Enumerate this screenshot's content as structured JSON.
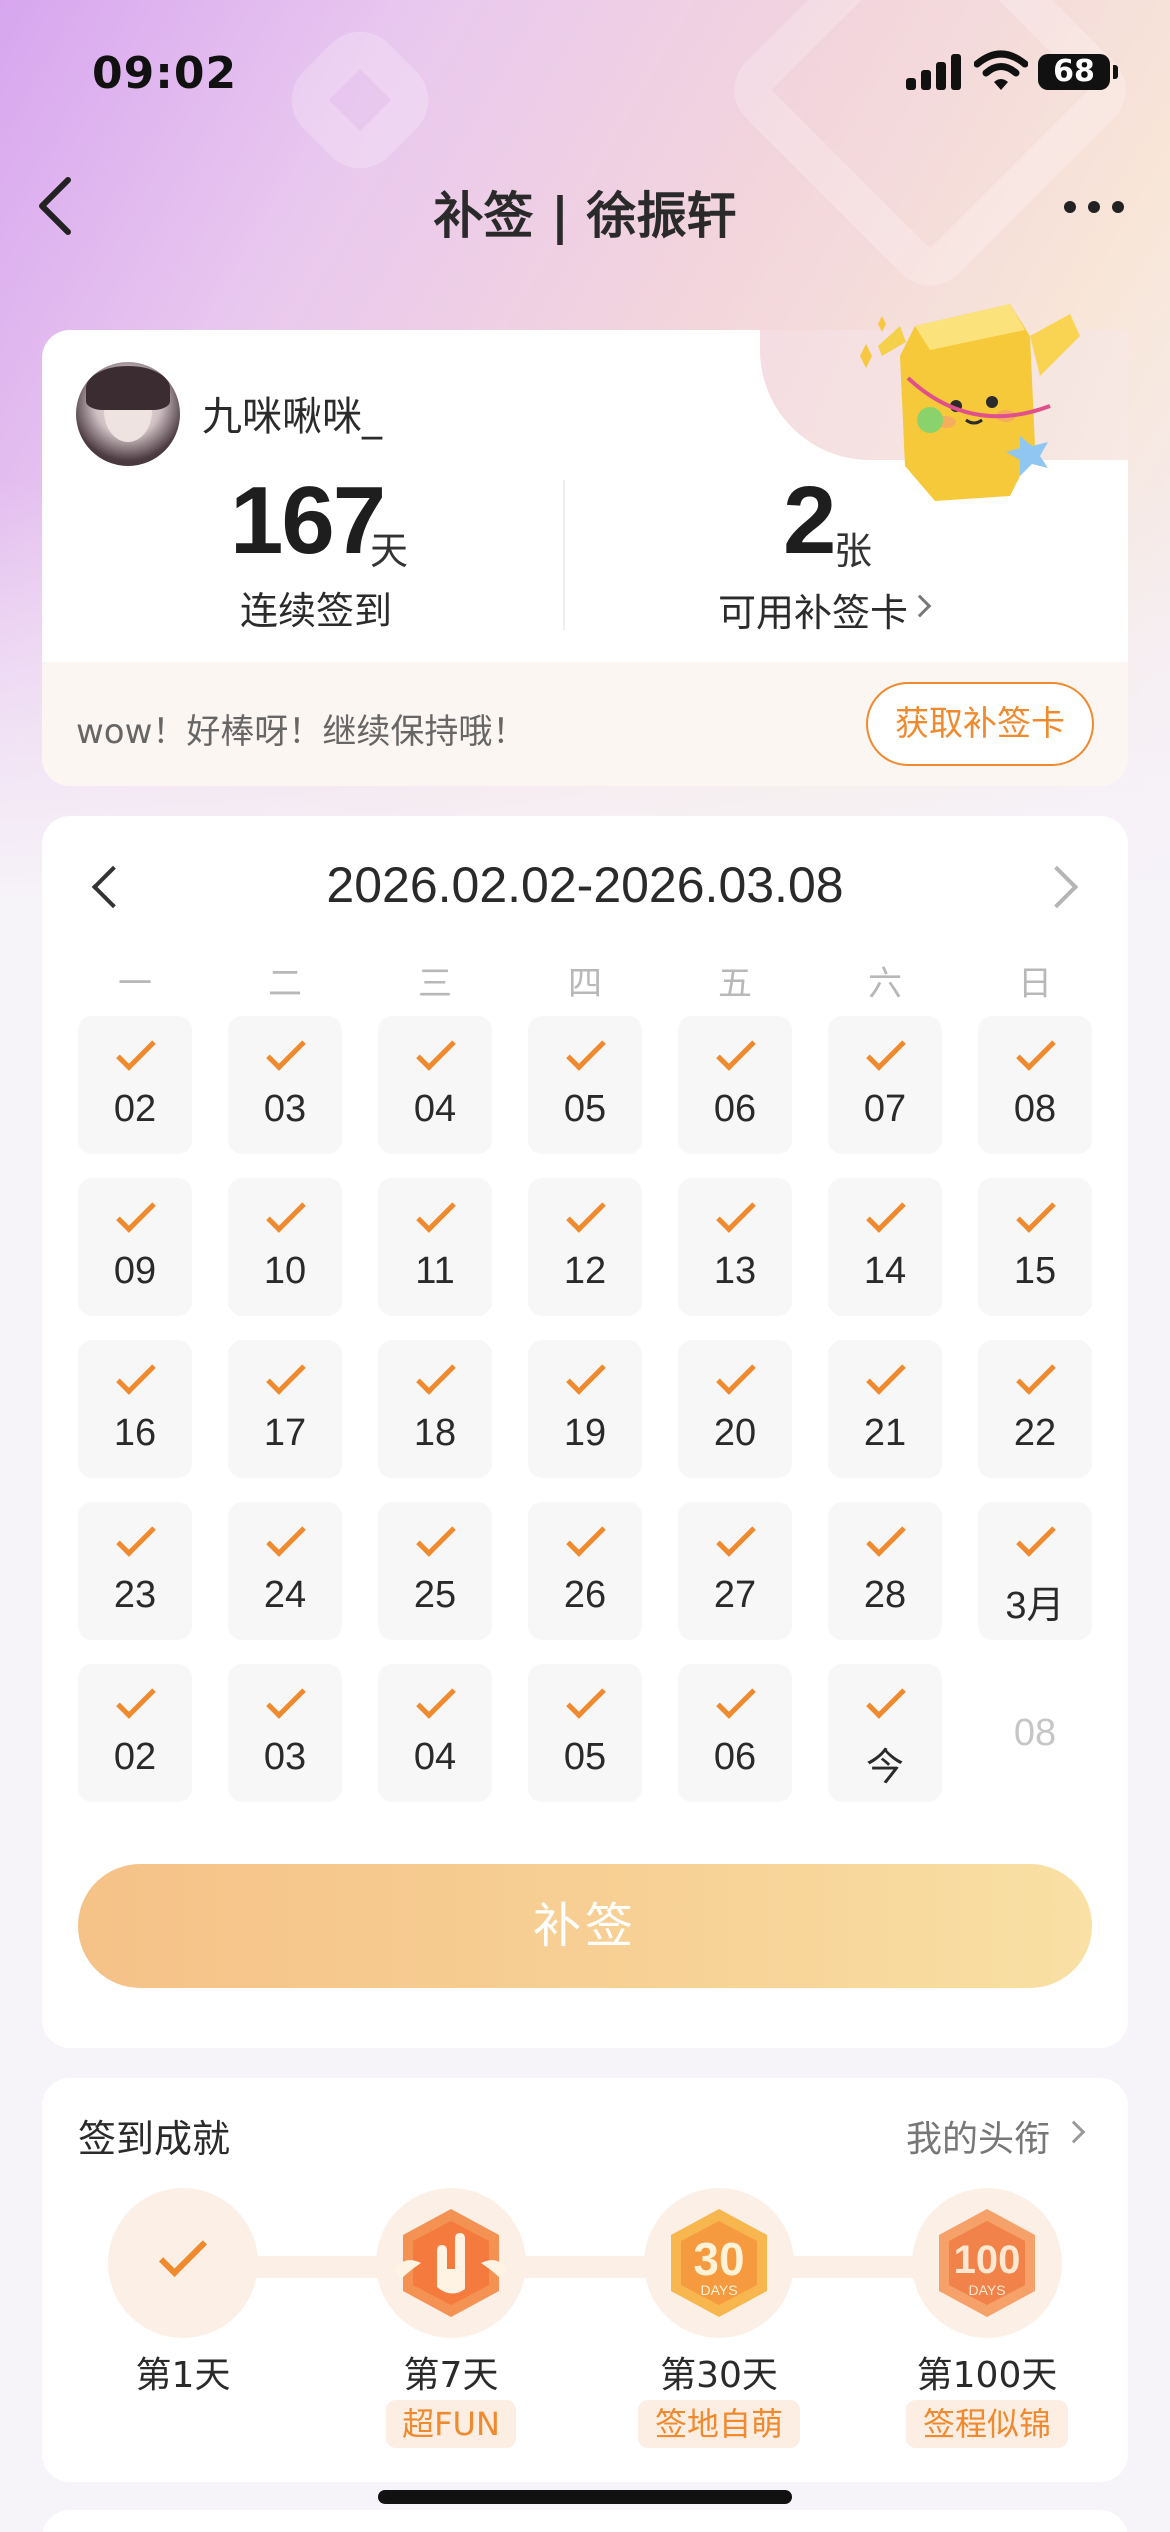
{
  "status_bar": {
    "time": "09:02",
    "battery": "68"
  },
  "nav": {
    "title": "补签 | 徐振轩"
  },
  "profile": {
    "username": "九咪啾咪_",
    "streak_value": "167",
    "streak_unit": "天",
    "streak_label": "连续签到",
    "cards_value": "2",
    "cards_unit": "张",
    "cards_label": "可用补签卡",
    "encourage_text": "wow！好棒呀！继续保持哦！",
    "get_card_button": "获取补签卡"
  },
  "calendar": {
    "range": "2026.02.02-2026.03.08",
    "weekdays": [
      "一",
      "二",
      "三",
      "四",
      "五",
      "六",
      "日"
    ],
    "weeks": [
      [
        {
          "label": "02",
          "checked": true
        },
        {
          "label": "03",
          "checked": true
        },
        {
          "label": "04",
          "checked": true
        },
        {
          "label": "05",
          "checked": true
        },
        {
          "label": "06",
          "checked": true
        },
        {
          "label": "07",
          "checked": true
        },
        {
          "label": "08",
          "checked": true
        }
      ],
      [
        {
          "label": "09",
          "checked": true
        },
        {
          "label": "10",
          "checked": true
        },
        {
          "label": "11",
          "checked": true
        },
        {
          "label": "12",
          "checked": true
        },
        {
          "label": "13",
          "checked": true
        },
        {
          "label": "14",
          "checked": true
        },
        {
          "label": "15",
          "checked": true
        }
      ],
      [
        {
          "label": "16",
          "checked": true
        },
        {
          "label": "17",
          "checked": true
        },
        {
          "label": "18",
          "checked": true
        },
        {
          "label": "19",
          "checked": true
        },
        {
          "label": "20",
          "checked": true
        },
        {
          "label": "21",
          "checked": true
        },
        {
          "label": "22",
          "checked": true
        }
      ],
      [
        {
          "label": "23",
          "checked": true
        },
        {
          "label": "24",
          "checked": true
        },
        {
          "label": "25",
          "checked": true
        },
        {
          "label": "26",
          "checked": true
        },
        {
          "label": "27",
          "checked": true
        },
        {
          "label": "28",
          "checked": true
        },
        {
          "label": "3月",
          "checked": true
        }
      ],
      [
        {
          "label": "02",
          "checked": true
        },
        {
          "label": "03",
          "checked": true
        },
        {
          "label": "04",
          "checked": true
        },
        {
          "label": "05",
          "checked": true
        },
        {
          "label": "06",
          "checked": true
        },
        {
          "label": "今",
          "checked": true
        },
        {
          "label": "08",
          "checked": false
        }
      ]
    ],
    "resign_button": "补签"
  },
  "achievements": {
    "title": "签到成就",
    "link": "我的头衔",
    "items": [
      {
        "day": "第1天",
        "tag": "",
        "icon": "check-icon"
      },
      {
        "day": "第7天",
        "tag": "超FUN",
        "icon": "rock-hand-badge-icon"
      },
      {
        "day": "第30天",
        "tag": "签地自萌",
        "icon": "30-days-badge-icon"
      },
      {
        "day": "第100天",
        "tag": "签程似锦",
        "icon": "100-days-badge-icon"
      }
    ]
  },
  "colors": {
    "accent": "#f08a2e",
    "button_gradient_start": "#f5c288",
    "button_gradient_end": "#f9e0a4"
  }
}
